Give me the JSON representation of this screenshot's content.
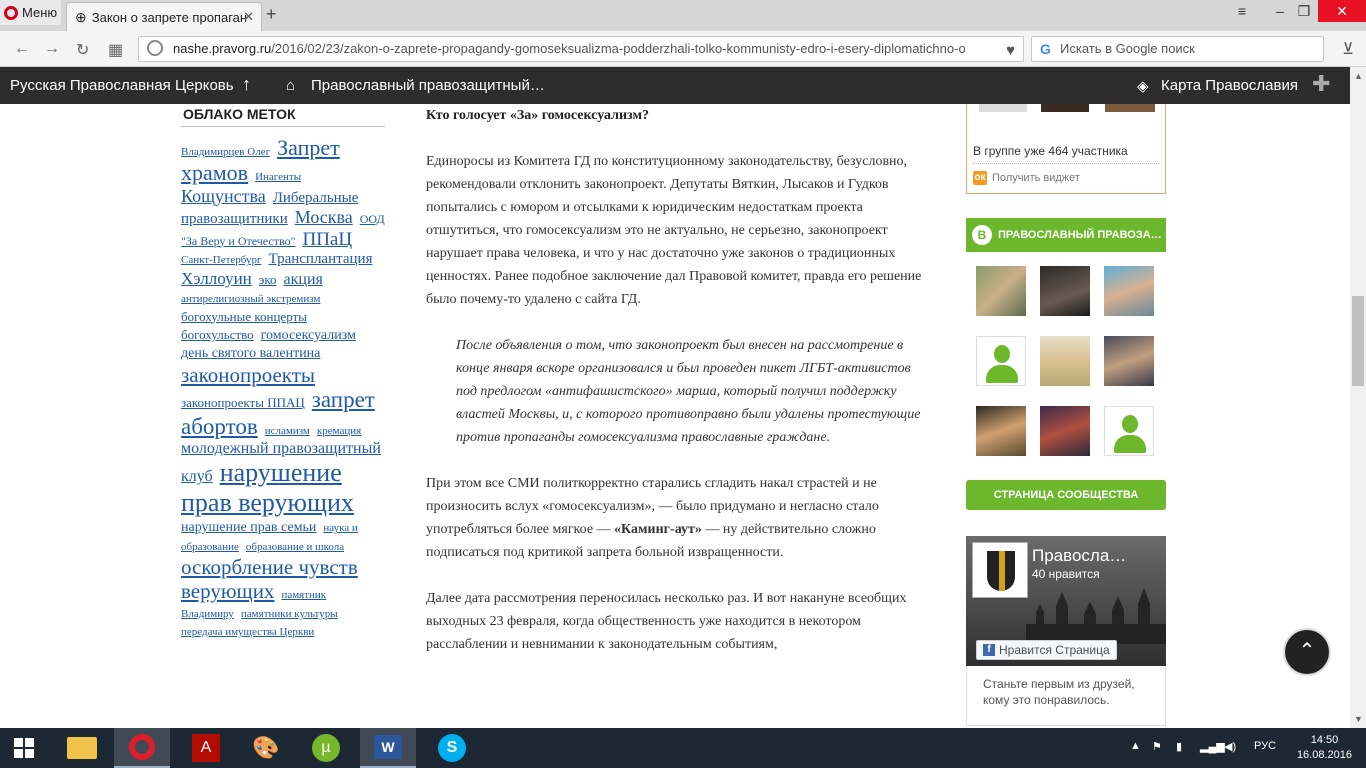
{
  "browser": {
    "menu_label": "Меню",
    "tab_title": "Закон о запрете пропаган",
    "url_host": "nashe.pravorg.ru",
    "url_path": "/2016/02/23/zakon-o-zaprete-propagandy-gomoseksualizma-podderzhali-tolko-kommunisty-edro-i-esery-diplomatichno-o",
    "search_placeholder": "Искать в Google поиск"
  },
  "bookmarks": {
    "item1": "Русская Православная Церковь",
    "item2": "Православный правозащитный…",
    "item3": "Карта Православия"
  },
  "tags": {
    "title": "ОБЛАКО МЕТОК",
    "items": [
      {
        "text": "Владимирцев Олег",
        "size": 11
      },
      {
        "text": "Запрет храмов",
        "size": 22
      },
      {
        "text": "Инагенты",
        "size": 11
      },
      {
        "text": "Кощунства",
        "size": 18
      },
      {
        "text": "Либеральные правозащитники",
        "size": 15
      },
      {
        "text": "Москва",
        "size": 18
      },
      {
        "text": "ООД \"За Веру и Отечество\"",
        "size": 12
      },
      {
        "text": "ППаЦ",
        "size": 19
      },
      {
        "text": "Санкт-Петербург",
        "size": 11
      },
      {
        "text": "Трансплантация",
        "size": 15
      },
      {
        "text": "Хэллоуин",
        "size": 17
      },
      {
        "text": "эко",
        "size": 13
      },
      {
        "text": "акция",
        "size": 16
      },
      {
        "text": "антирелигиозный экстремизм",
        "size": 11
      },
      {
        "text": "богохульные концерты",
        "size": 13
      },
      {
        "text": "богохульство",
        "size": 13
      },
      {
        "text": "гомосексуализм",
        "size": 14
      },
      {
        "text": "день святого валентина",
        "size": 14
      },
      {
        "text": "законопроекты",
        "size": 21
      },
      {
        "text": "законопроекты ППАЦ",
        "size": 13
      },
      {
        "text": "запрет абортов",
        "size": 23
      },
      {
        "text": "исламизм",
        "size": 11
      },
      {
        "text": "кремация",
        "size": 11
      },
      {
        "text": "молодежный правозащитный клуб",
        "size": 16
      },
      {
        "text": "нарушение прав верующих",
        "size": 26
      },
      {
        "text": "нарушение прав семьи",
        "size": 14
      },
      {
        "text": "наука и образование",
        "size": 11
      },
      {
        "text": "образование и школа",
        "size": 11
      },
      {
        "text": "оскорбление чувств верующих",
        "size": 21
      },
      {
        "text": "памятник",
        "size": 11
      },
      {
        "text": "Владимиру",
        "size": 11
      },
      {
        "text": "памятники культуры",
        "size": 11
      },
      {
        "text": "передача имущества Церкви",
        "size": 11
      }
    ]
  },
  "article": {
    "heading": "Кто голосует «За» гомосексуализм?",
    "p1": "Единоросы из Комитета ГД по конституционному законодательству, безусловно, рекомендовали отклонить законопроект. Депутаты Вяткин, Лысаков и Гудков попытались с юмором и отсылками к юридическим недостаткам проекта отшутиться, что гомосексуализм это не актуально, не серьезно, законопроект нарушает права человека, и что у нас достаточно уже законов о традиционных ценностях. Ранее подобное заключение дал Правовой комитет, правда его решение было почему-то удалено с сайта ГД.",
    "quote": "После объявления о том, что законопроект был внесен на рассмотрение в конце января вскоре организовался и был проведен пикет ЛГБТ-активистов под предлогом «антифашистского» марша, который получил поддержку властей Москвы, и, с которого противоправно были удалены протестующие против пропаганды гомосексуализма православные граждане.",
    "p2_start": "При этом все СМИ политкорректно старались сгладить накал страстей и не произносить вслух «гомосексуализм», — было придумано и негласно стало употребляться более мягкое — ",
    "p2_bold": "«Каминг-аут»",
    "p2_end": " — ну действительно сложно подписаться под критикой запрета больной извращенности.",
    "p3": "Далее дата рассмотрения переносилась несколько раз. И вот накануне всеобщих выходных 23 февраля, когда общественность уже находится в некотором расслаблении и невнимании к законодательным событиям,"
  },
  "sidebar": {
    "ok_count": "В группе уже 464 участника",
    "ok_get": "Получить виджет",
    "vk_title": "ПРАВОСЛАВНЫЙ ПРАВОЗА…",
    "vk_button": "СТРАНИЦА СООБЩЕСТВА",
    "fb_name": "Правосла…",
    "fb_likes": "40 нравится",
    "fb_like_button": "Нравится Страница",
    "fb_friends": "Станьте первым из друзей, кому это понравилось."
  },
  "taskbar": {
    "lang": "РУС",
    "time": "14:50",
    "date": "16.08.2016"
  }
}
